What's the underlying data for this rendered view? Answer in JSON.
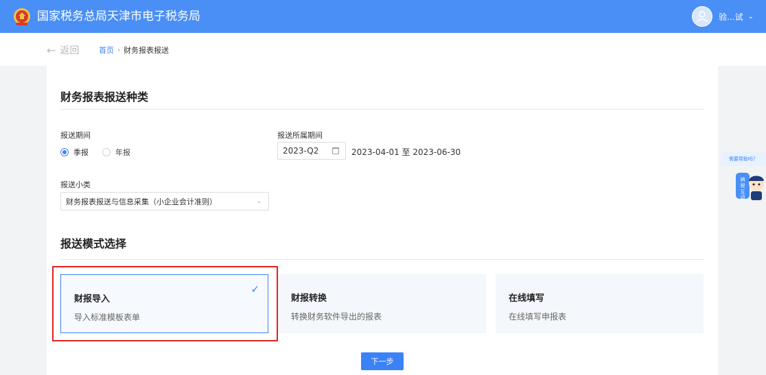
{
  "header": {
    "site_title": "国家税务总局天津市电子税务局",
    "username": "验...试",
    "brand_color": "#4a8ff5"
  },
  "nav": {
    "back_label": "返回",
    "breadcrumb_home": "首页",
    "breadcrumb_current": "财务报表报送"
  },
  "form": {
    "section_title": "财务报表报送种类",
    "period_label": "报送期间",
    "period_options": [
      {
        "label": "季报",
        "selected": true
      },
      {
        "label": "年报",
        "selected": false
      }
    ],
    "belong_period_label": "报送所属期间",
    "belong_period_value": "2023-Q2",
    "belong_period_range": "2023-04-01 至 2023-06-30",
    "subtype_label": "报送小类",
    "subtype_value": "财务报表报送与信息采集（小企业会计准则）"
  },
  "mode": {
    "section_title": "报送模式选择",
    "cards": [
      {
        "title": "财报导入",
        "desc": "导入标准模板表单",
        "selected": true
      },
      {
        "title": "财报转换",
        "desc": "转换财务软件导出的报表",
        "selected": false
      },
      {
        "title": "在线填写",
        "desc": "在线填写申报表",
        "selected": false
      }
    ]
  },
  "actions": {
    "next_label": "下一步"
  },
  "help": {
    "tab_label": "需要帮助吗？",
    "mascot_text": "纳税互动"
  },
  "colors": {
    "accent": "#3b82f6",
    "highlight": "#e02020"
  }
}
